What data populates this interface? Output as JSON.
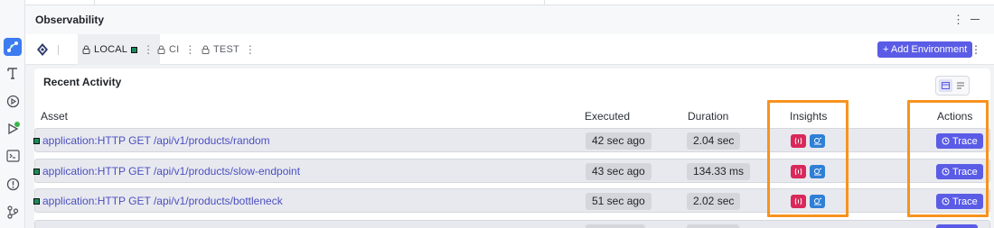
{
  "header": {
    "title": "Observability"
  },
  "environments": {
    "tabs": [
      {
        "label": "LOCAL",
        "active": true
      },
      {
        "label": "CI",
        "active": false
      },
      {
        "label": "TEST",
        "active": false
      }
    ],
    "add_label": "+ Add Environment"
  },
  "panel": {
    "title": "Recent Activity",
    "columns": {
      "asset": "Asset",
      "executed": "Executed",
      "duration": "Duration",
      "insights": "Insights",
      "actions": "Actions"
    },
    "rows": [
      {
        "asset": "application:HTTP GET /api/v1/products/random",
        "executed": "42 sec ago",
        "duration": "2.04 sec",
        "action": "Trace"
      },
      {
        "asset": "application:HTTP GET /api/v1/products/slow-endpoint",
        "executed": "43 sec ago",
        "duration": "134.33 ms",
        "action": "Trace"
      },
      {
        "asset": "application:HTTP GET /api/v1/products/bottleneck",
        "executed": "51 sec ago",
        "duration": "2.02 sec",
        "action": "Trace"
      }
    ]
  },
  "icons": {
    "activity_bar": [
      "observability-icon",
      "tests-icon",
      "run-icon",
      "debug-icon",
      "terminal-icon",
      "problems-icon",
      "git-icon"
    ],
    "insights": [
      "bottleneck-insight-icon",
      "endpoint-insight-icon"
    ]
  },
  "colors": {
    "accent": "#5b5ce6",
    "highlight": "#f7931e",
    "insight_red": "#d9285a",
    "insight_blue": "#2f7fd6",
    "env_marker": "#1d8a5a"
  }
}
